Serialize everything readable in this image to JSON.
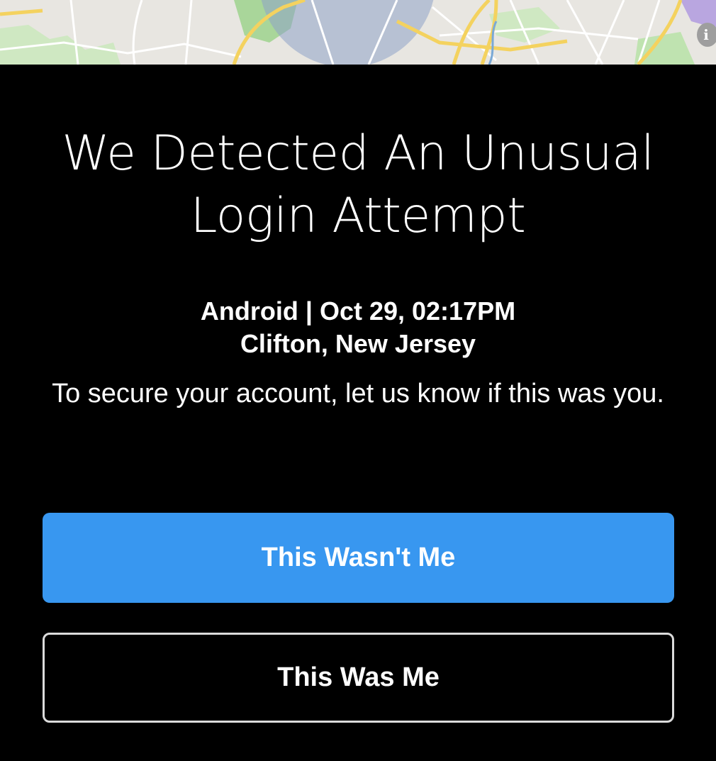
{
  "map": {
    "info_icon": "info-icon",
    "info_glyph": "i",
    "colors": {
      "land": "#e8e6e1",
      "park": "#bfe3b0",
      "road_major": "#f4d25f",
      "road_minor": "#ffffff",
      "location_radius": "#8ea3c8",
      "district": "#b9a6e0"
    }
  },
  "alert": {
    "title": "We Detected An Unusual Login Attempt",
    "device_line": "Android | Oct 29, 02:17PM",
    "location_line": "Clifton, New Jersey",
    "prompt": "To secure your account, let us know if this was you."
  },
  "actions": {
    "primary_label": "This Wasn't Me",
    "secondary_label": "This Was Me",
    "primary_color": "#3897f0",
    "secondary_border_color": "#dbdbdb"
  },
  "colors": {
    "background": "#000000",
    "text": "#ffffff"
  }
}
